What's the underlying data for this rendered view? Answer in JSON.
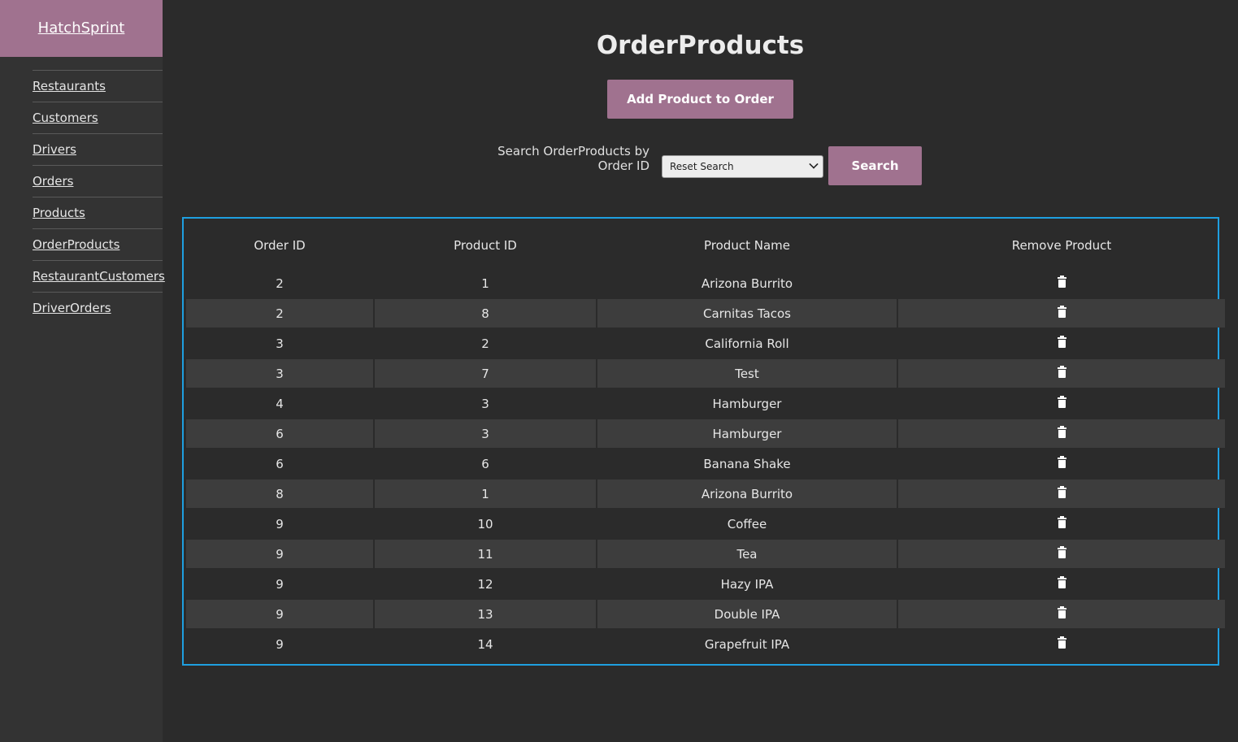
{
  "app": {
    "brand": "HatchSprint"
  },
  "sidebar": {
    "items": [
      {
        "label": "Restaurants"
      },
      {
        "label": "Customers"
      },
      {
        "label": "Drivers"
      },
      {
        "label": "Orders"
      },
      {
        "label": "Products"
      },
      {
        "label": "OrderProducts"
      },
      {
        "label": "RestaurantCustomers"
      },
      {
        "label": "DriverOrders"
      }
    ]
  },
  "main": {
    "title": "OrderProducts",
    "add_button": "Add Product to Order",
    "search": {
      "label": "Search OrderProducts by Order ID",
      "selected": "Reset Search",
      "button": "Search"
    },
    "table": {
      "headers": [
        "Order ID",
        "Product ID",
        "Product Name",
        "Remove Product"
      ],
      "rows": [
        {
          "order_id": "2",
          "product_id": "1",
          "product_name": "Arizona Burrito"
        },
        {
          "order_id": "2",
          "product_id": "8",
          "product_name": "Carnitas Tacos"
        },
        {
          "order_id": "3",
          "product_id": "2",
          "product_name": "California Roll"
        },
        {
          "order_id": "3",
          "product_id": "7",
          "product_name": "Test"
        },
        {
          "order_id": "4",
          "product_id": "3",
          "product_name": "Hamburger"
        },
        {
          "order_id": "6",
          "product_id": "3",
          "product_name": "Hamburger"
        },
        {
          "order_id": "6",
          "product_id": "6",
          "product_name": "Banana Shake"
        },
        {
          "order_id": "8",
          "product_id": "1",
          "product_name": "Arizona Burrito"
        },
        {
          "order_id": "9",
          "product_id": "10",
          "product_name": "Coffee"
        },
        {
          "order_id": "9",
          "product_id": "11",
          "product_name": "Tea"
        },
        {
          "order_id": "9",
          "product_id": "12",
          "product_name": "Hazy IPA"
        },
        {
          "order_id": "9",
          "product_id": "13",
          "product_name": "Double IPA"
        },
        {
          "order_id": "9",
          "product_id": "14",
          "product_name": "Grapefruit IPA"
        }
      ],
      "remove_icon": "trash-icon"
    }
  },
  "colors": {
    "accent": "#a0728f",
    "background": "#2b2b2b",
    "sidebar": "#333333",
    "table_border": "#1e9fe0",
    "row_alt": "#3d3d3d"
  }
}
